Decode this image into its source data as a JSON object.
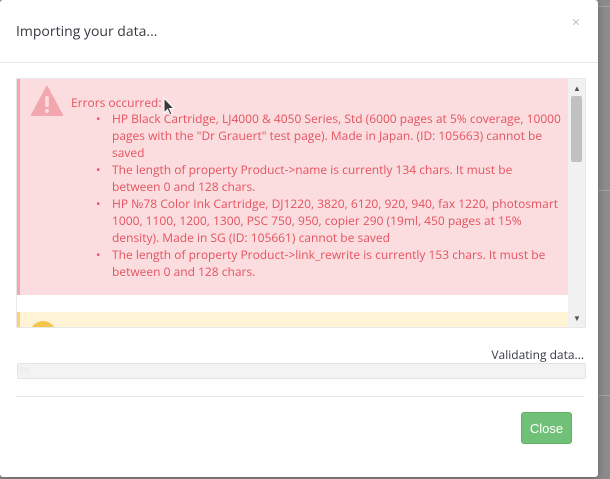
{
  "modal": {
    "title": "Importing your data...",
    "close_glyph": "×"
  },
  "errors": {
    "title": "Errors occurred:",
    "items": [
      "HP Black Cartridge, LJ4000 & 4050 Series, Std (6000 pages at 5% coverage, 10000 pages with the \"Dr Grauert\" test page). Made in Japan. (ID: 105663) cannot be saved",
      "The length of property Product->name is currently 134 chars. It must be between 0 and 128 chars.",
      "HP №78 Color Ink Cartridge, DJ1220, 3820, 6120, 920, 940, fax 1220, photosmart 1000, 1100, 1200, 1300, PSC 750, 950, copier 290 (19ml, 450 pages at 15% density). Made in SG (ID: 105661) cannot be saved",
      "The length of property Product->link_rewrite is currently 153 chars. It must be between 0 and 128 chars."
    ]
  },
  "status": {
    "text": "Validating data..."
  },
  "progress": {
    "label": "0%",
    "value_percent": 0
  },
  "footer": {
    "close_label": "Close"
  },
  "colors": {
    "danger_bg": "#fbdde0",
    "danger_text": "#e4535e",
    "warning_bg": "#fff3d6",
    "success_button": "#70c078"
  },
  "icons": {
    "error": "warning-triangle-icon",
    "warning": "warning-circle-icon"
  }
}
